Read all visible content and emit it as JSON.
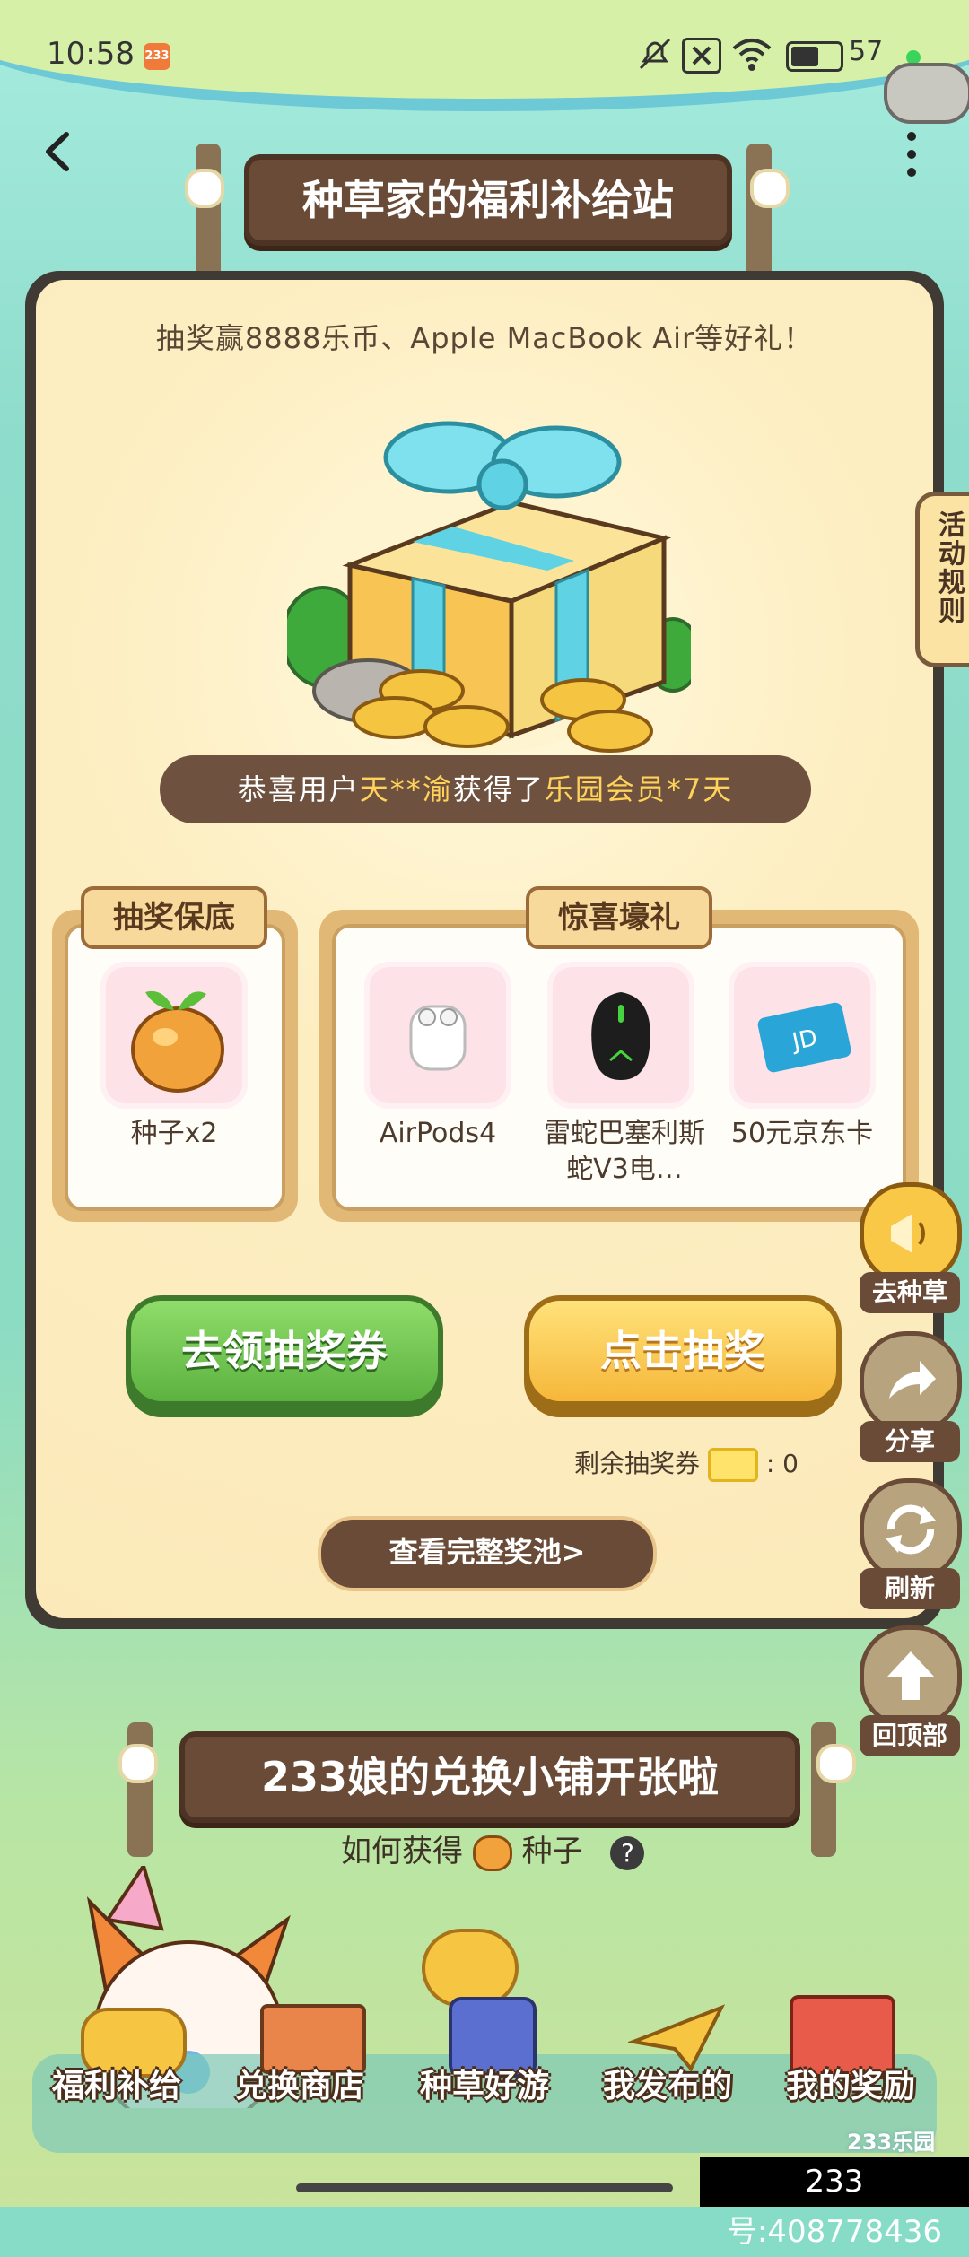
{
  "status_bar": {
    "time": "10:58",
    "app_badge": "233",
    "battery": "57"
  },
  "header": {
    "title": "种草家的福利补给站"
  },
  "rules_tab": {
    "label": "活动规则"
  },
  "lottery": {
    "promo_text": "抽奖赢8888乐币、Apple MacBook Air等好礼！",
    "winner": {
      "prefix": "恭喜用户",
      "user": "天**渝",
      "mid": "获得了",
      "prize": "乐园会员*7天"
    },
    "guarantee": {
      "title": "抽奖保底",
      "items": [
        {
          "name": "种子x2"
        }
      ]
    },
    "surprise": {
      "title": "惊喜壕礼",
      "items": [
        {
          "name": "AirPods4"
        },
        {
          "name": "雷蛇巴塞利斯蛇V3电…"
        },
        {
          "name": "50元京东卡"
        }
      ]
    },
    "get_tickets_button": "去领抽奖券",
    "draw_button": "点击抽奖",
    "remaining_label": "剩余抽奖券",
    "remaining_sep": ":",
    "remaining_count": "0",
    "full_pool_button": "查看完整奖池>"
  },
  "side_buttons": [
    {
      "label": "去种草",
      "icon": "megaphone-icon"
    },
    {
      "label": "分享",
      "icon": "share-icon"
    },
    {
      "label": "刷新",
      "icon": "refresh-icon"
    },
    {
      "label": "回顶部",
      "icon": "arrow-up-icon"
    }
  ],
  "shop": {
    "title": "233娘的兑换小铺开张啦",
    "hint_prefix": "如何获得",
    "hint_suffix": "种子"
  },
  "bottom_nav": [
    {
      "label": "福利补给"
    },
    {
      "label": "兑换商店"
    },
    {
      "label": "种草好游"
    },
    {
      "label": "我发布的"
    },
    {
      "label": "我的奖励"
    }
  ],
  "watermark": {
    "brand": "233乐园",
    "account": "233号:408778436"
  },
  "colors": {
    "accent_green": "#6fc24e",
    "accent_yellow": "#f6c343",
    "wood": "#6a4b37",
    "highlight": "#ffd35a"
  }
}
